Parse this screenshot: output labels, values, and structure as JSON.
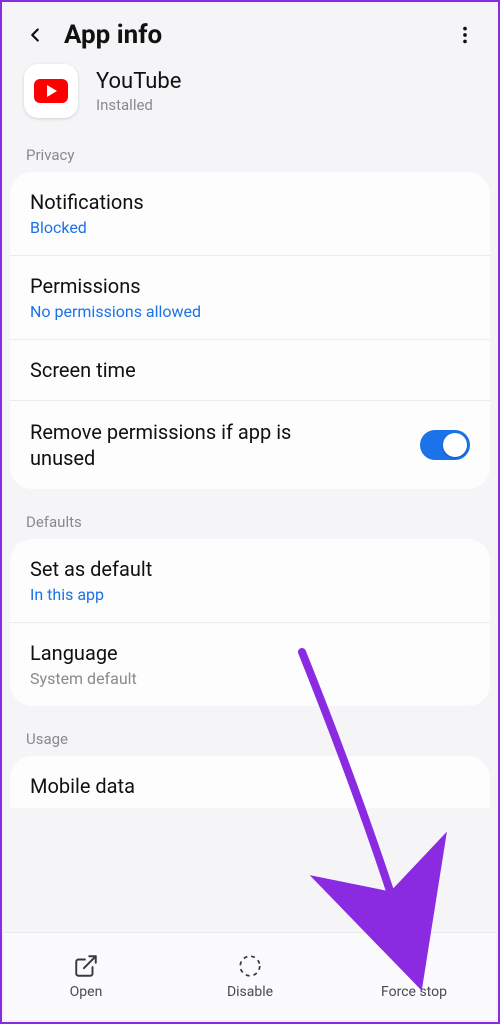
{
  "header": {
    "title": "App info"
  },
  "app": {
    "name": "YouTube",
    "status": "Installed"
  },
  "sections": {
    "privacy_label": "Privacy",
    "defaults_label": "Defaults",
    "usage_label": "Usage"
  },
  "privacy": {
    "notifications": {
      "title": "Notifications",
      "value": "Blocked"
    },
    "permissions": {
      "title": "Permissions",
      "value": "No permissions allowed"
    },
    "screen_time": {
      "title": "Screen time"
    },
    "remove_perms": {
      "title": "Remove permissions if app is unused",
      "toggled": true
    }
  },
  "defaults": {
    "set_default": {
      "title": "Set as default",
      "value": "In this app"
    },
    "language": {
      "title": "Language",
      "value": "System default"
    }
  },
  "usage": {
    "mobile_data": {
      "title": "Mobile data"
    }
  },
  "bottom": {
    "open": "Open",
    "disable": "Disable",
    "force_stop": "Force stop"
  },
  "colors": {
    "accent_blue": "#1a73e8",
    "annotation_purple": "#8a2be2"
  }
}
